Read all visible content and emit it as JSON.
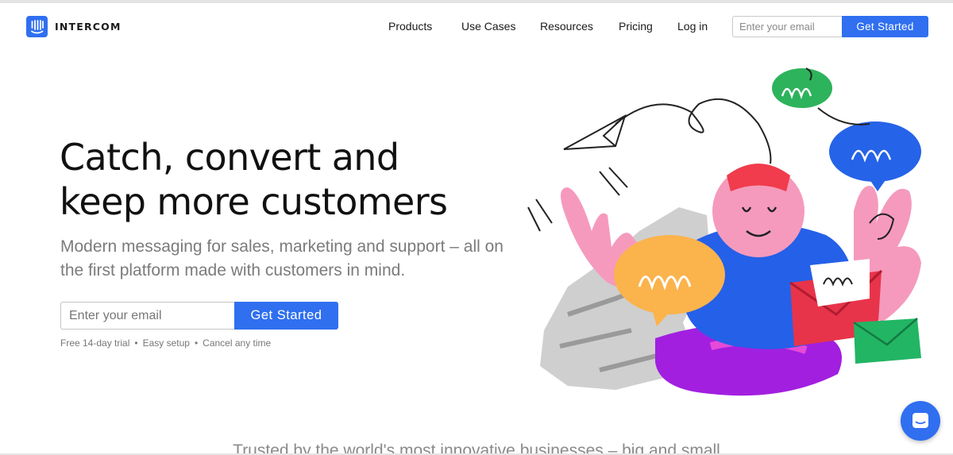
{
  "brand": {
    "name": "INTERCOM",
    "color": "#2f6ff0"
  },
  "nav": {
    "items": [
      {
        "label": "Products"
      },
      {
        "label": "Use Cases"
      },
      {
        "label": "Resources"
      },
      {
        "label": "Pricing"
      },
      {
        "label": "Log in"
      }
    ],
    "email_placeholder": "Enter your email",
    "cta_label": "Get Started"
  },
  "hero": {
    "title_line1": "Catch, convert and",
    "title_line2": "keep more customers",
    "subtitle": "Modern messaging for sales, marketing and support – all on the first platform made with customers in mind.",
    "email_placeholder": "Enter your email",
    "cta_label": "Get Started",
    "perks": [
      "Free 14-day trial",
      "Easy setup",
      "Cancel any time"
    ],
    "perk_separator": "•"
  },
  "trusted": {
    "text": "Trusted by the world's most innovative businesses – big and small"
  },
  "icons": {
    "logo": "intercom-logo-icon",
    "chat": "chat-launcher-icon",
    "illustration": "hero-character-illustration"
  }
}
